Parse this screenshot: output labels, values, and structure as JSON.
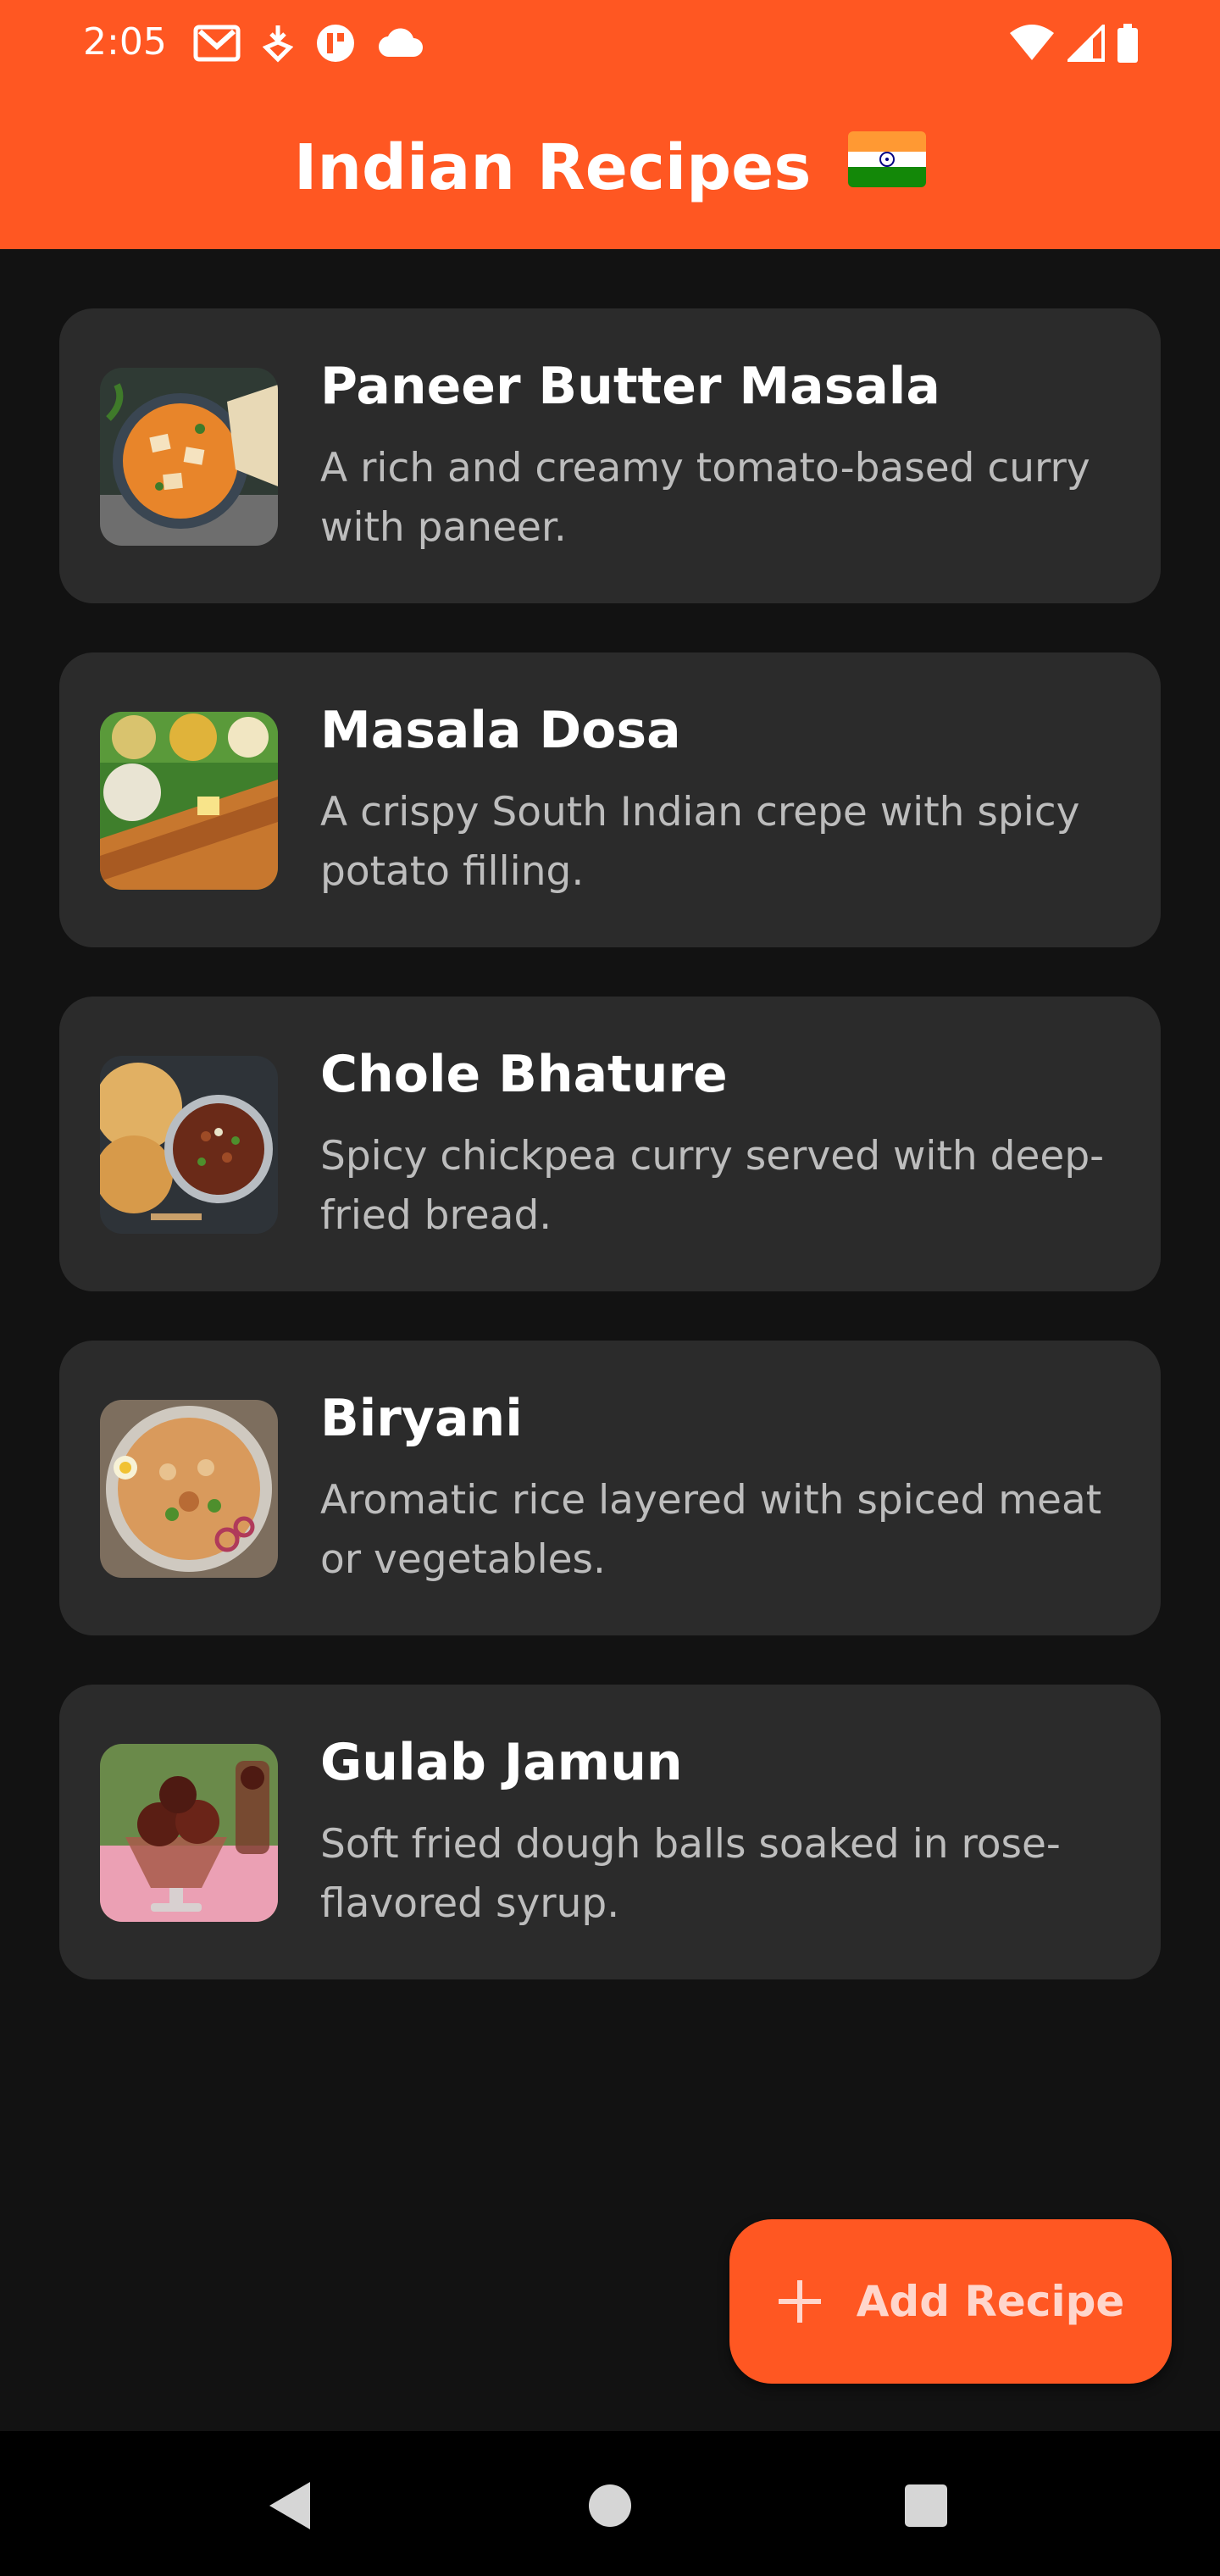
{
  "status_bar": {
    "time": "2:05",
    "left_icons": [
      "gmail-icon",
      "cast-download-icon",
      "app-notification-icon",
      "cloud-icon"
    ],
    "right_icons": [
      "wifi-icon",
      "signal-icon",
      "battery-icon"
    ]
  },
  "app_bar": {
    "title": "Indian Recipes",
    "title_emoji_icon": "india-flag-icon",
    "background_color": "#FF5722"
  },
  "recipes": [
    {
      "name": "Paneer Butter Masala",
      "description": "A rich and creamy tomato-based curry with paneer.",
      "image_icon": "paneer-butter-masala-image"
    },
    {
      "name": "Masala Dosa",
      "description": "A crispy South Indian crepe with spicy potato filling.",
      "image_icon": "masala-dosa-image"
    },
    {
      "name": "Chole Bhature",
      "description": "Spicy chickpea curry served with deep-fried bread.",
      "image_icon": "chole-bhature-image"
    },
    {
      "name": "Biryani",
      "description": "Aromatic rice layered with spiced meat or vegetables.",
      "image_icon": "biryani-image"
    },
    {
      "name": "Gulab Jamun",
      "description": "Soft fried dough balls soaked in rose-flavored syrup.",
      "image_icon": "gulab-jamun-image"
    }
  ],
  "fab": {
    "label": "Add Recipe",
    "icon": "plus-icon",
    "background_color": "#FF5722"
  },
  "nav_bar": {
    "buttons": [
      "back-icon",
      "home-icon",
      "recents-icon"
    ]
  }
}
